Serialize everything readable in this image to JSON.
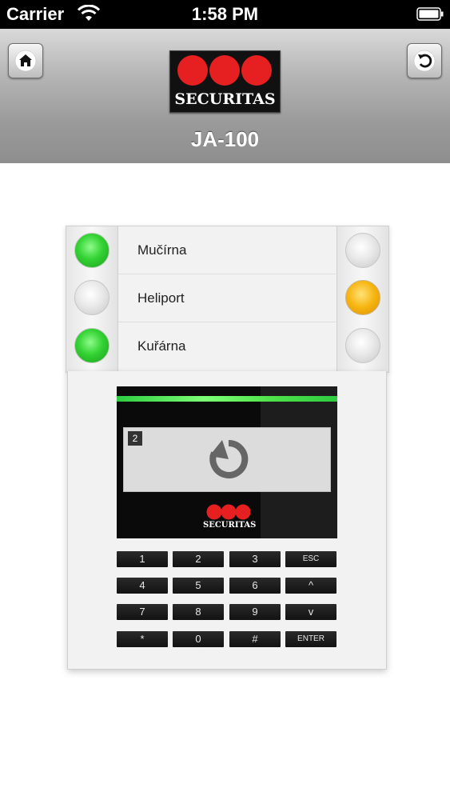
{
  "status_bar": {
    "carrier": "Carrier",
    "time": "1:58 PM"
  },
  "header": {
    "title": "JA-100",
    "logo_text": "SECURITAS",
    "home_icon": "home-icon",
    "back_icon": "undo-icon"
  },
  "zones": [
    {
      "label": "Mučírna",
      "left_led": "green",
      "right_led": "off"
    },
    {
      "label": "Heliport",
      "left_led": "off",
      "right_led": "orange"
    },
    {
      "label": "Kuřárna",
      "left_led": "green",
      "right_led": "off"
    }
  ],
  "display": {
    "number": "2",
    "icon": "busy-progress-icon",
    "logo_text": "SECURITAS"
  },
  "keypad": {
    "keys": [
      "1",
      "2",
      "3",
      "ESC",
      "4",
      "5",
      "6",
      "^",
      "7",
      "8",
      "9",
      "v",
      "*",
      "0",
      "#",
      "ENTER"
    ]
  },
  "colors": {
    "led_green": "#34d234",
    "led_orange": "#f6b40e",
    "brand_red": "#e62020",
    "display_bar": "#4fe24a"
  }
}
